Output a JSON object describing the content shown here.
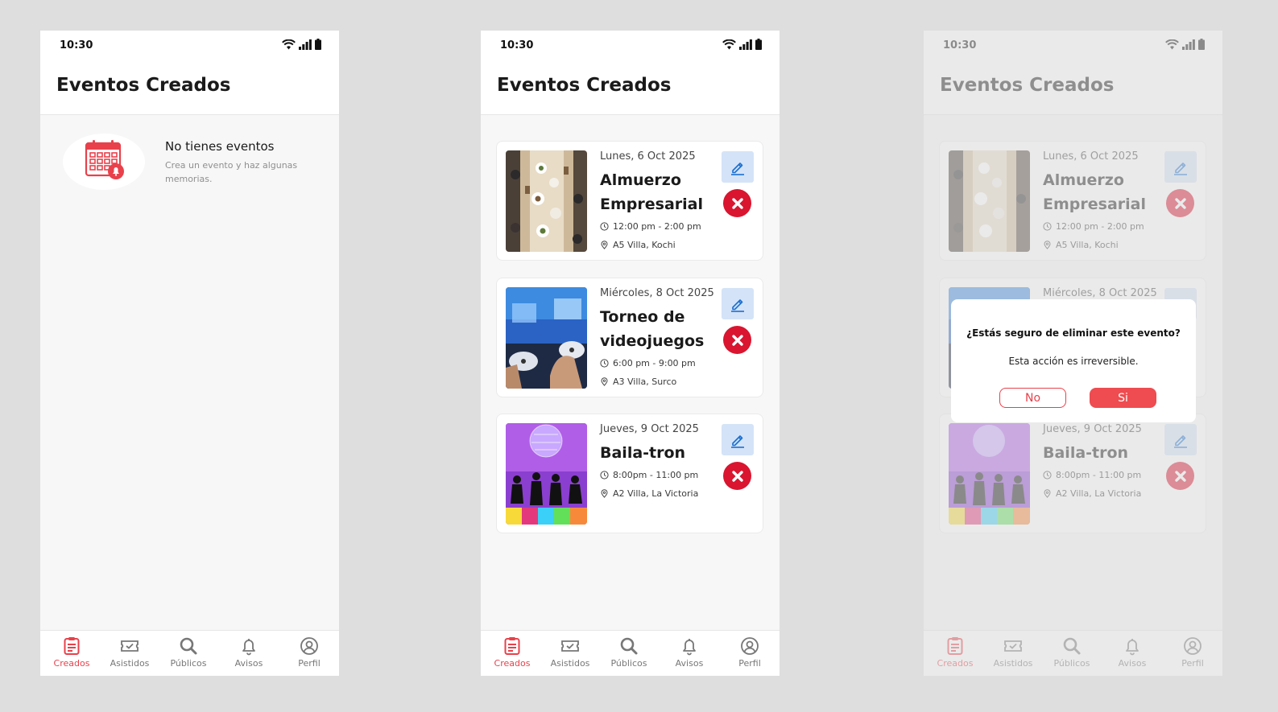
{
  "status_bar": {
    "time": "10:30"
  },
  "page": {
    "title": "Eventos Creados"
  },
  "empty_state": {
    "title": "No tienes eventos",
    "subtitle": "Crea un evento y haz algunas memorias."
  },
  "events": [
    {
      "date": "Lunes, 6 Oct 2025",
      "name": "Almuerzo Empresarial",
      "time": "12:00 pm - 2:00 pm",
      "location": "A5 Villa, Kochi"
    },
    {
      "date": "Miércoles, 8 Oct 2025",
      "name": "Torneo de videojuegos",
      "time": "6:00 pm - 9:00 pm",
      "location": "A3 Villa, Surco"
    },
    {
      "date": "Jueves, 9 Oct 2025",
      "name": "Baila-tron",
      "time": "8:00pm - 11:00 pm",
      "location": "A2 Villa, La Victoria"
    }
  ],
  "tabbar": {
    "items": [
      {
        "label": "Creados",
        "icon": "clipboard-icon",
        "active": true
      },
      {
        "label": "Asistidos",
        "icon": "ticket-icon",
        "active": false
      },
      {
        "label": "Públicos",
        "icon": "search-icon",
        "active": false
      },
      {
        "label": "Avisos",
        "icon": "bell-icon",
        "active": false
      },
      {
        "label": "Perfil",
        "icon": "profile-icon",
        "active": false
      }
    ]
  },
  "dialog": {
    "title": "¿Estás seguro de eliminar este evento?",
    "message": "Esta acción es irreversible.",
    "no_label": "No",
    "yes_label": "Si"
  },
  "colors": {
    "accent": "#e8414b",
    "delete": "#d9152f",
    "edit_bg": "#d4e3f7",
    "edit_icon": "#1a6fd1"
  }
}
